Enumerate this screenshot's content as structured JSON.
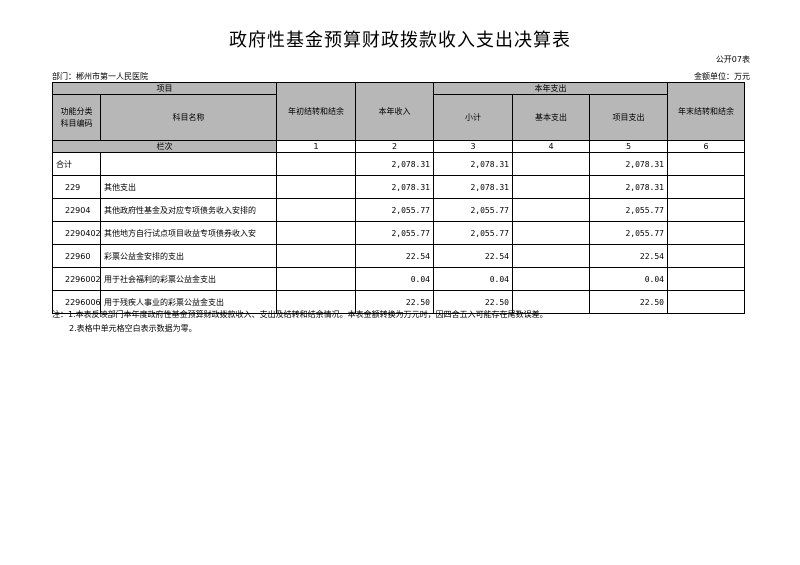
{
  "title": "政府性基金预算财政拨款收入支出决算表",
  "table_code": "公开07表",
  "department": "部门：郴州市第一人民医院",
  "unit": "金额单位：万元",
  "headers": {
    "project": "项目",
    "current_expenditure": "本年支出",
    "func_code": "功能分类\n科目编码",
    "subject_name": "科目名称",
    "opening_balance": "年初结转和结余",
    "current_income": "本年收入",
    "subtotal": "小计",
    "basic_expenditure": "基本支出",
    "project_expenditure": "项目支出",
    "closing_balance": "年末结转和结余",
    "column_index": "栏次",
    "col_numbers": [
      "1",
      "2",
      "3",
      "4",
      "5",
      "6"
    ]
  },
  "rows": [
    {
      "code": "合计",
      "name": "",
      "opening": "",
      "income": "2,078.31",
      "subtotal": "2,078.31",
      "basic": "",
      "project": "2,078.31",
      "closing": ""
    },
    {
      "code": "229",
      "name": "其他支出",
      "opening": "",
      "income": "2,078.31",
      "subtotal": "2,078.31",
      "basic": "",
      "project": "2,078.31",
      "closing": ""
    },
    {
      "code": "22904",
      "name": "其他政府性基金及对应专项债务收入安排的",
      "opening": "",
      "income": "2,055.77",
      "subtotal": "2,055.77",
      "basic": "",
      "project": "2,055.77",
      "closing": ""
    },
    {
      "code": "2290402",
      "name": "其他地方自行试点项目收益专项债券收入安",
      "opening": "",
      "income": "2,055.77",
      "subtotal": "2,055.77",
      "basic": "",
      "project": "2,055.77",
      "closing": ""
    },
    {
      "code": "22960",
      "name": "彩票公益金安排的支出",
      "opening": "",
      "income": "22.54",
      "subtotal": "22.54",
      "basic": "",
      "project": "22.54",
      "closing": ""
    },
    {
      "code": "2296002",
      "name": "用于社会福利的彩票公益金支出",
      "opening": "",
      "income": "0.04",
      "subtotal": "0.04",
      "basic": "",
      "project": "0.04",
      "closing": ""
    },
    {
      "code": "2296006",
      "name": "用于残疾人事业的彩票公益金支出",
      "opening": "",
      "income": "22.50",
      "subtotal": "22.50",
      "basic": "",
      "project": "22.50",
      "closing": ""
    }
  ],
  "notes": [
    "注：1.本表反映部门本年度政府性基金预算财政拨款收入、支出及结转和结余情况。本表金额转换为万元时，因四舍五入可能存在尾数误差。",
    "2.表格中单元格空白表示数据为零。"
  ]
}
